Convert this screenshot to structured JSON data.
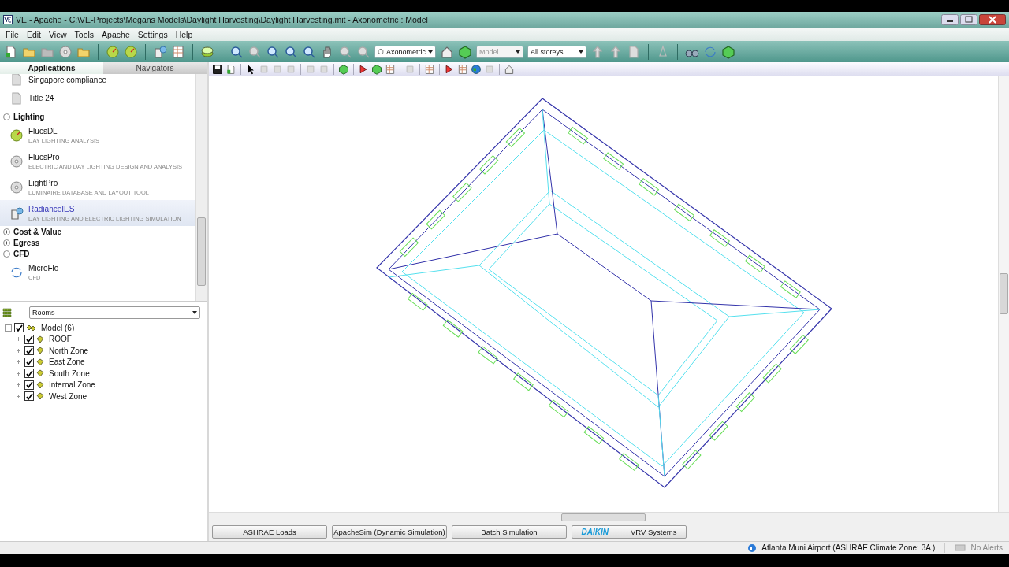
{
  "window": {
    "title": "VE - Apache - C:\\VE-Projects\\Megans Models\\Daylight Harvesting\\Daylight Harvesting.mit - Axonometric : Model"
  },
  "menu": [
    "File",
    "Edit",
    "View",
    "Tools",
    "Apache",
    "Settings",
    "Help"
  ],
  "toolbar": {
    "view_mode": {
      "value": "Axonometric",
      "disabled": false
    },
    "model": {
      "value": "Model",
      "disabled": true
    },
    "storeys": {
      "value": "All storeys",
      "disabled": false
    }
  },
  "panel_tabs": [
    {
      "label": "Applications",
      "selected": true
    },
    {
      "label": "Navigators",
      "selected": false
    }
  ],
  "applications": [
    {
      "kind": "app",
      "name": "Singapore compliance",
      "selected": false
    },
    {
      "kind": "app",
      "name": "Title 24",
      "selected": false
    },
    {
      "kind": "group",
      "name": "Lighting",
      "expanded": true,
      "children": [
        {
          "name": "FlucsDL",
          "subtitle": "DAY LIGHTING ANALYSIS",
          "selected": false
        },
        {
          "name": "FlucsPro",
          "subtitle": "ELECTRIC AND DAY LIGHTING DESIGN AND ANALYSIS",
          "selected": false
        },
        {
          "name": "LightPro",
          "subtitle": "LUMINAIRE DATABASE AND LAYOUT TOOL",
          "selected": false
        },
        {
          "name": "RadianceIES",
          "subtitle": "DAY LIGHTING AND ELECTRIC LIGHTING SIMULATION",
          "selected": true
        }
      ]
    },
    {
      "kind": "group",
      "name": "Cost & Value",
      "expanded": false
    },
    {
      "kind": "group",
      "name": "Egress",
      "expanded": false
    },
    {
      "kind": "group",
      "name": "CFD",
      "expanded": true,
      "children": [
        {
          "name": "MicroFlo",
          "subtitle": "CFD",
          "selected": false
        }
      ]
    }
  ],
  "rooms": {
    "filter": "Rooms",
    "tree": {
      "label": "Model (6)",
      "checked": true,
      "expanded": true,
      "children": [
        {
          "label": "ROOF",
          "checked": true
        },
        {
          "label": "North Zone",
          "checked": true
        },
        {
          "label": "East Zone",
          "checked": true
        },
        {
          "label": "South Zone",
          "checked": true
        },
        {
          "label": "Internal Zone",
          "checked": true
        },
        {
          "label": "West Zone",
          "checked": true
        }
      ]
    }
  },
  "bottom_buttons": [
    {
      "kind": "plain",
      "label": "ASHRAE Loads"
    },
    {
      "kind": "plain",
      "label": "ApacheSim (Dynamic Simulation)"
    },
    {
      "kind": "plain",
      "label": "Batch Simulation"
    },
    {
      "kind": "branded",
      "logo": "DAIKIN",
      "label": "VRV Systems"
    }
  ],
  "status_bar": {
    "location": "Atlanta Muni Airport  (ASHRAE Climate Zone: 3A )",
    "alerts": "No Alerts"
  }
}
